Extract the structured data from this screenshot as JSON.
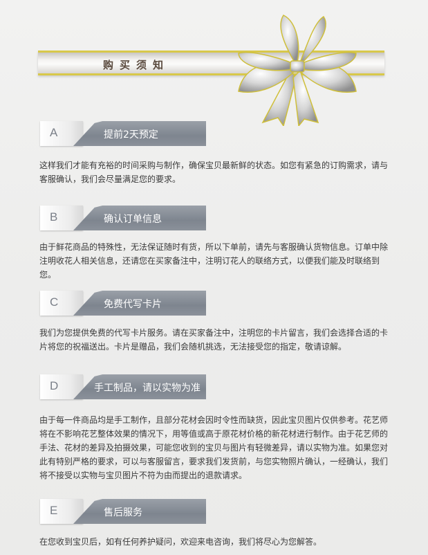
{
  "header": {
    "title": "购买须知"
  },
  "colors": {
    "ribbon": "#858b94",
    "gold": "#d8c84a",
    "text": "#3a3a3a"
  },
  "sections": [
    {
      "letter": "A",
      "title": "提前2天预定",
      "text": "这样我们才能有充裕的时间采购与制作，确保宝贝最新鲜的状态。如您有紧急的订购需求，请与客服确认，我们会尽量满足您的要求。"
    },
    {
      "letter": "B",
      "title": "确认订单信息",
      "text": "由于鲜花商品的特殊性，无法保证随时有货，所以下单前，请先与客服确认货物信息。订单中除注明收花人相关信息，还请您在买家备注中，注明订花人的联络方式，以便我们能及时联络到您。"
    },
    {
      "letter": "C",
      "title": "免费代写卡片",
      "text": "我们为您提供免费的代写卡片服务。请在买家备注中，注明您的卡片留言，我们会选择合适的卡片将您的祝福送出。卡片是赠品，我们会随机挑选，无法接受您的指定，敬请谅解。"
    },
    {
      "letter": "D",
      "title": "手工制品，请以实物为准",
      "text": "由于每一件商品均是手工制作，且部分花材会因时令性而缺货，因此宝贝图片仅供参考。花艺师将在不影响花艺整体效果的情况下，用等值或高于原花材价格的新花材进行制作。由于花艺师的手法、花材的差异及拍摄效果，可能您收到的宝贝与图片有轻微差异，请以实物为准。如果您对此有特别严格的要求，可以与客服留言，要求我们发货前，与您实物照片确认，一经确认，我们将不接受以实物与宝贝图片不符为由而提出的退款请求。"
    },
    {
      "letter": "E",
      "title": "售后服务",
      "text": "在您收到宝贝后，如有任何养护疑问，欢迎来电咨询，我们将尽心为您解答。"
    }
  ]
}
